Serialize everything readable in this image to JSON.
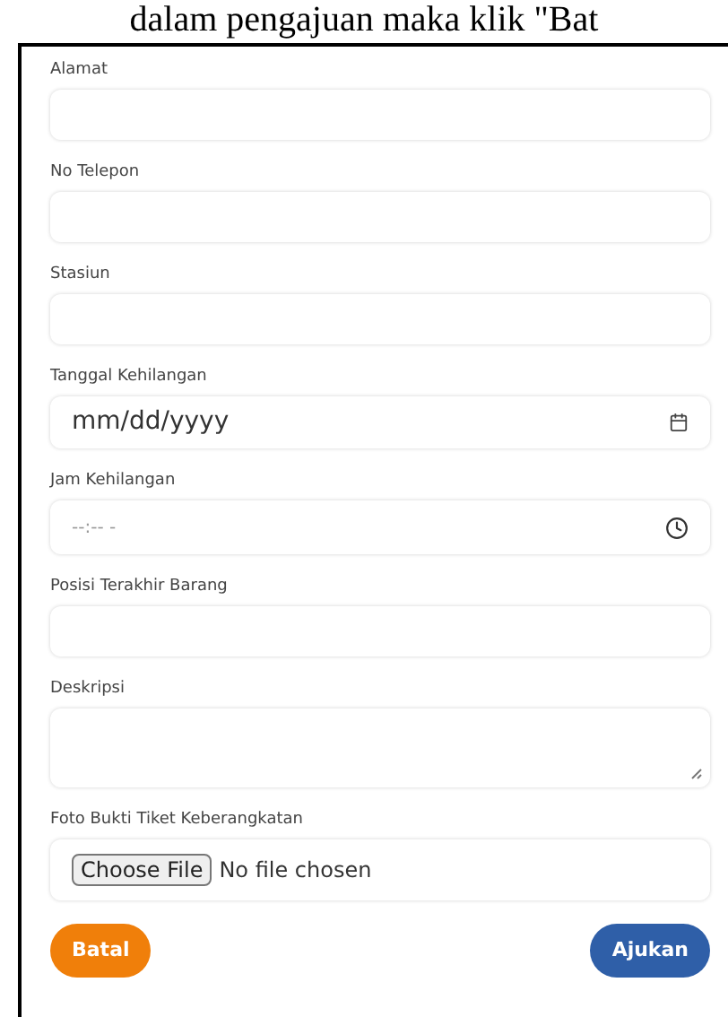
{
  "caption": "dalam pengajuan maka klik \"Bat",
  "fields": [
    {
      "label": "Alamat",
      "kind": "text"
    },
    {
      "label": "No Telepon",
      "kind": "text"
    },
    {
      "label": "Stasiun",
      "kind": "text"
    },
    {
      "label": "Tanggal Kehilangan",
      "kind": "date",
      "placeholder": "mm/dd/yyyy"
    },
    {
      "label": "Jam Kehilangan",
      "kind": "time",
      "placeholder": "--:-- -"
    },
    {
      "label": "Posisi Terakhir Barang",
      "kind": "text"
    },
    {
      "label": "Deskripsi",
      "kind": "textarea"
    },
    {
      "label": "Foto Bukti Tiket Keberangkatan",
      "kind": "file",
      "button": "Choose File",
      "status": "No file chosen"
    }
  ],
  "buttons": [
    {
      "label": "Batal",
      "kind": "cancel"
    },
    {
      "label": "Ajukan",
      "kind": "submit"
    }
  ]
}
